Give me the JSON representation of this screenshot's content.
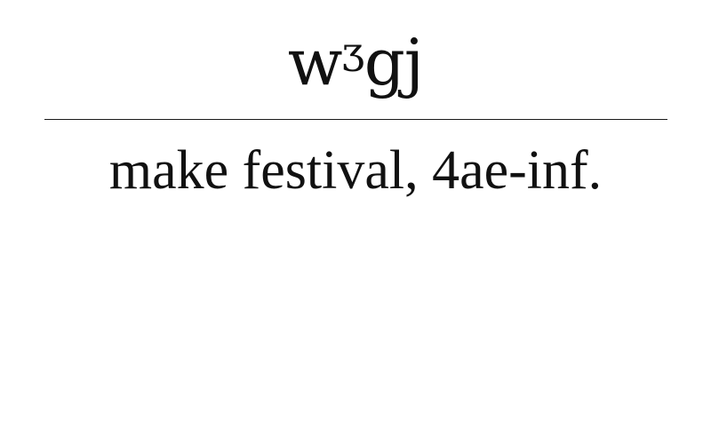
{
  "card": {
    "headword": "wᶾgj",
    "definition": "make festival, 4ae-inf."
  }
}
